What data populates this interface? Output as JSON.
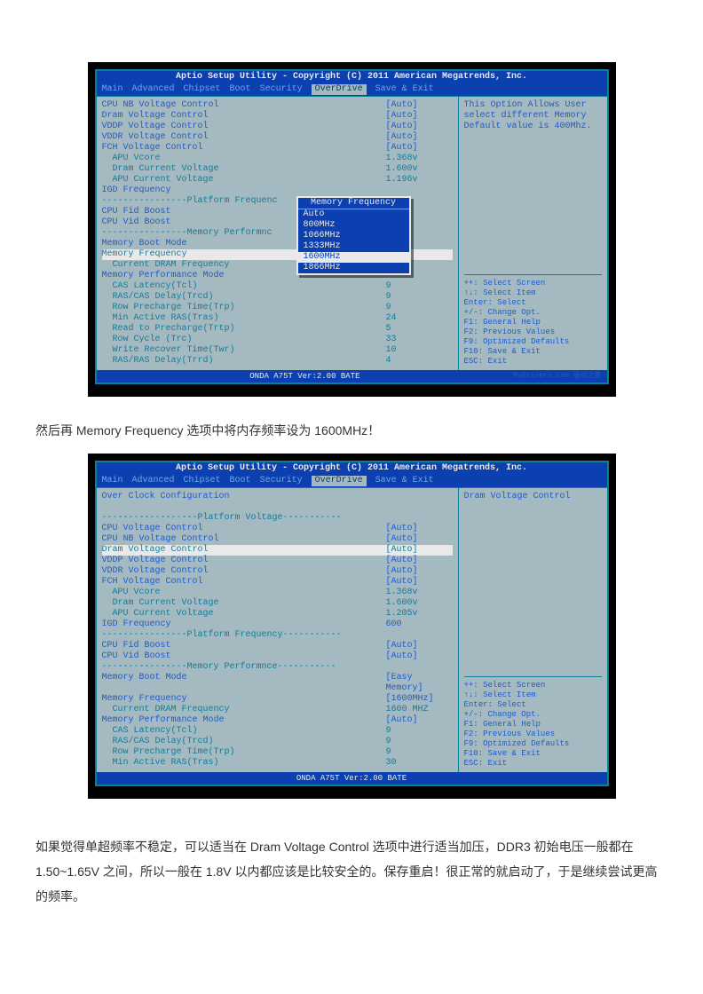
{
  "bios_a": {
    "title": "Aptio Setup Utility - Copyright (C) 2011 American Megatrends, Inc.",
    "menu": [
      "Main",
      "Advanced",
      "Chipset",
      "Boot",
      "Security",
      "OverDrive",
      "Save & Exit"
    ],
    "menu_sel": "OverDrive",
    "left": {
      "rows": [
        {
          "lbl": "CPU NB Voltage Control",
          "val": "[Auto]",
          "cls": "blue"
        },
        {
          "lbl": "Dram Voltage Control",
          "val": "[Auto]",
          "cls": "blue"
        },
        {
          "lbl": "VDDP Voltage Control",
          "val": "[Auto]",
          "cls": "blue"
        },
        {
          "lbl": "VDDR Voltage Control",
          "val": "[Auto]",
          "cls": "blue"
        },
        {
          "lbl": "FCH Voltage Control",
          "val": "[Auto]",
          "cls": "blue"
        },
        {
          "lbl": "  APU Vcore",
          "val": "1.368v",
          "cls": ""
        },
        {
          "lbl": "  Dram Current Voltage",
          "val": "1.600v",
          "cls": ""
        },
        {
          "lbl": "  APU Current Voltage",
          "val": "1.196v",
          "cls": ""
        },
        {
          "lbl": "IGD Frequency",
          "val": "",
          "cls": "blue"
        },
        {
          "lbl": "----------------Platform Frequenc",
          "val": "",
          "cls": "dash"
        },
        {
          "lbl": "CPU Fid Boost",
          "val": "",
          "cls": "blue"
        },
        {
          "lbl": "CPU Vid Boost",
          "val": "",
          "cls": "blue"
        },
        {
          "lbl": "----------------Memory Performnc",
          "val": "",
          "cls": "dash"
        },
        {
          "lbl": "Memory Boot Mode",
          "val": "",
          "cls": "blue"
        },
        {
          "lbl": "Memory Frequency",
          "val": "",
          "cls": "hl"
        },
        {
          "lbl": "  Current DRAM Frequency",
          "val": "",
          "cls": ""
        },
        {
          "lbl": "Memory Performance Mode",
          "val": "",
          "cls": "blue"
        },
        {
          "lbl": "  CAS Latency(Tcl)",
          "val": "9",
          "cls": ""
        },
        {
          "lbl": "  RAS/CAS Delay(Trcd)",
          "val": "9",
          "cls": ""
        },
        {
          "lbl": "  Row Precharge Time(Trp)",
          "val": "9",
          "cls": ""
        },
        {
          "lbl": "  Min Active RAS(Tras)",
          "val": "24",
          "cls": ""
        },
        {
          "lbl": "  Read to Precharge(Trtp)",
          "val": "5",
          "cls": ""
        },
        {
          "lbl": "  Row Cycle (Trc)",
          "val": "33",
          "cls": ""
        },
        {
          "lbl": "  Write Recover Time(Twr)",
          "val": "10",
          "cls": ""
        },
        {
          "lbl": "  RAS/RAS Delay(Trrd)",
          "val": "4",
          "cls": ""
        }
      ]
    },
    "popup": {
      "title": "Memory Frequency",
      "items": [
        "Auto",
        "800MHz",
        "1066MHz",
        "1333MHz",
        "1600MHz",
        "1866MHz"
      ],
      "sel": "1600MHz"
    },
    "right_top": "This Option Allows User select different Memory Default value is 400Mhz.",
    "right_bot": [
      "++: Select Screen",
      "↑↓: Select Item",
      "Enter: Select",
      "+/-: Change Opt.",
      "F1: General Help",
      "F2: Previous Values",
      "F9: Optimized Defaults",
      "F10: Save & Exit",
      "ESC: Exit"
    ],
    "footer": "ONDA A75T Ver:2.00 BATE",
    "watermark": "MyDrivers.com 驱动之家"
  },
  "para1": "然后再 Memory Frequency 选项中将内存频率设为 1600MHz！",
  "bios_b": {
    "title": "Aptio Setup Utility - Copyright (C) 2011 American Megatrends, Inc.",
    "menu": [
      "Main",
      "Advanced",
      "Chipset",
      "Boot",
      "Security",
      "OverDrive",
      "Save & Exit"
    ],
    "menu_sel": "OverDrive",
    "heading": "Over Clock Configuration",
    "rows": [
      {
        "lbl": "------------------Platform Voltage-----------",
        "val": "",
        "cls": "dash"
      },
      {
        "lbl": "CPU Voltage Control",
        "val": "[Auto]",
        "cls": "blue"
      },
      {
        "lbl": "CPU NB Voltage Control",
        "val": "[Auto]",
        "cls": "blue"
      },
      {
        "lbl": "Dram Voltage Control",
        "val": "[Auto]",
        "cls": "hl"
      },
      {
        "lbl": "VDDP Voltage Control",
        "val": "[Auto]",
        "cls": "blue"
      },
      {
        "lbl": "VDDR Voltage Control",
        "val": "[Auto]",
        "cls": "blue"
      },
      {
        "lbl": "FCH Voltage Control",
        "val": "[Auto]",
        "cls": "blue"
      },
      {
        "lbl": "  APU Vcore",
        "val": "1.368v",
        "cls": ""
      },
      {
        "lbl": "  Dram Current Voltage",
        "val": "1.600v",
        "cls": ""
      },
      {
        "lbl": "  APU Current Voltage",
        "val": "1.205v",
        "cls": ""
      },
      {
        "lbl": "IGD Frequency",
        "val": "600",
        "cls": "blue"
      },
      {
        "lbl": "----------------Platform Frequency-----------",
        "val": "",
        "cls": "dash"
      },
      {
        "lbl": "CPU Fid Boost",
        "val": "[Auto]",
        "cls": "blue"
      },
      {
        "lbl": "CPU Vid Boost",
        "val": "[Auto]",
        "cls": "blue"
      },
      {
        "lbl": "----------------Memory Performnce-----------",
        "val": "",
        "cls": "dash"
      },
      {
        "lbl": "Memory Boot Mode",
        "val": "[Easy Memory]",
        "cls": "blue"
      },
      {
        "lbl": "Memory Frequency",
        "val": "[1600MHz]",
        "cls": "blue"
      },
      {
        "lbl": "  Current DRAM Frequency",
        "val": "1600 MHZ",
        "cls": ""
      },
      {
        "lbl": "Memory Performance Mode",
        "val": "[Auto]",
        "cls": "blue"
      },
      {
        "lbl": "  CAS Latency(Tcl)",
        "val": "9",
        "cls": ""
      },
      {
        "lbl": "  RAS/CAS Delay(Trcd)",
        "val": "9",
        "cls": ""
      },
      {
        "lbl": "  Row Precharge Time(Trp)",
        "val": "9",
        "cls": ""
      },
      {
        "lbl": "  Min Active RAS(Tras)",
        "val": "30",
        "cls": ""
      }
    ],
    "right_top": "Dram Voltage Control",
    "right_bot": [
      "++: Select Screen",
      "↑↓: Select Item",
      "Enter: Select",
      "+/-: Change Opt.",
      "F1: General Help",
      "F2: Previous Values",
      "F9: Optimized Defaults",
      "F10: Save & Exit",
      "ESC: Exit"
    ],
    "footer": "ONDA A75T Ver:2.00 BATE"
  },
  "para2": "如果觉得单超频率不稳定，可以适当在 Dram Voltage Control 选项中进行适当加压，DDR3 初始电压一般都在 1.50~1.65V 之间，所以一般在 1.8V 以内都应该是比较安全的。保存重启！很正常的就启动了，于是继续尝试更高的频率。"
}
